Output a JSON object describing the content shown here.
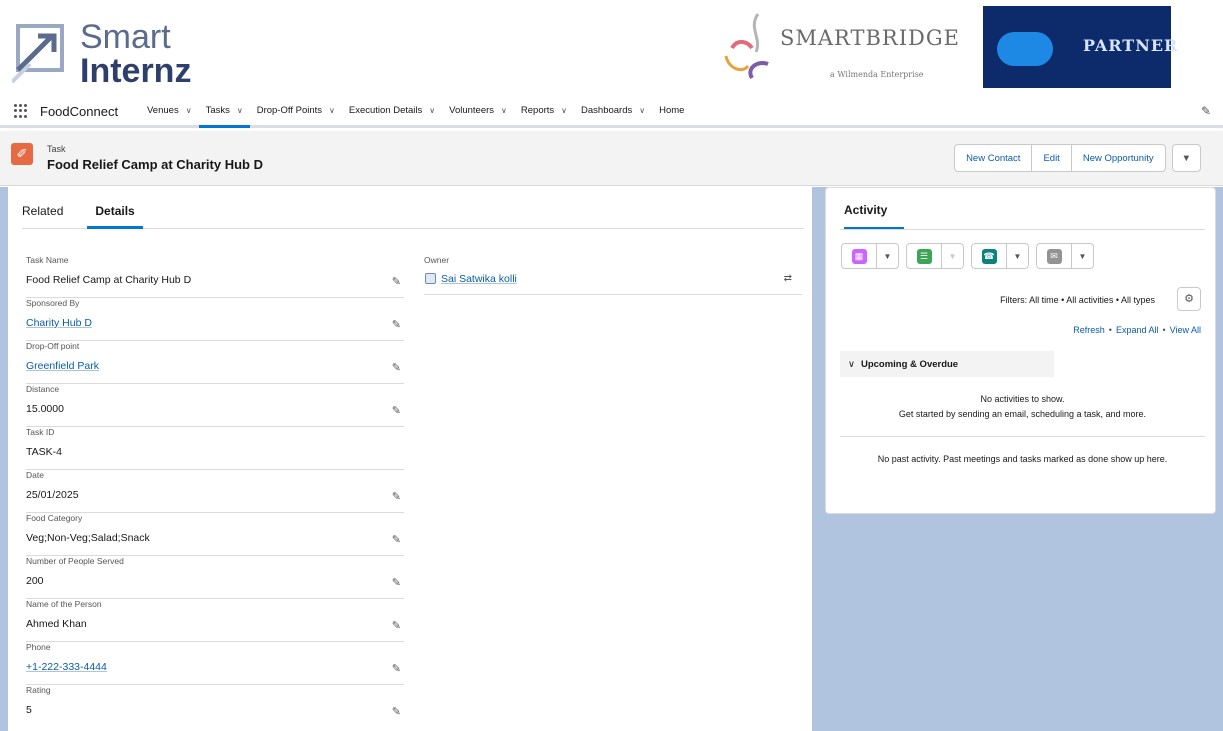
{
  "branding": {
    "smartinternz_line1": "Smart",
    "smartinternz_line2": "Internz",
    "smartbridge_name": "SMARTBRIDGE",
    "smartbridge_sub": "a Wilmenda Enterprise",
    "partner_label": "PARTNER"
  },
  "nav": {
    "app_name": "FoodConnect",
    "items": [
      {
        "label": "Venues",
        "has_menu": true
      },
      {
        "label": "Tasks",
        "has_menu": true,
        "active": true
      },
      {
        "label": "Drop-Off Points",
        "has_menu": true
      },
      {
        "label": "Execution Details",
        "has_menu": true
      },
      {
        "label": "Volunteers",
        "has_menu": true
      },
      {
        "label": "Reports",
        "has_menu": true
      },
      {
        "label": "Dashboards",
        "has_menu": true
      },
      {
        "label": "Home",
        "has_menu": false
      }
    ]
  },
  "record": {
    "object_label": "Task",
    "title": "Food Relief Camp at Charity Hub D",
    "actions": {
      "new_contact": "New Contact",
      "edit": "Edit",
      "new_opportunity": "New Opportunity"
    }
  },
  "tabs": {
    "related": "Related",
    "details": "Details"
  },
  "fields": [
    {
      "label": "Task Name",
      "value": "Food Relief Camp at Charity Hub D",
      "link": false,
      "editable": true
    },
    {
      "label": "Sponsored By",
      "value": "Charity Hub D",
      "link": true,
      "editable": true
    },
    {
      "label": "Drop-Off point",
      "value": "Greenfield Park",
      "link": true,
      "editable": true
    },
    {
      "label": "Distance",
      "value": "15.0000",
      "link": false,
      "editable": true
    },
    {
      "label": "Task ID",
      "value": "TASK-4",
      "link": false,
      "editable": false
    },
    {
      "label": "Date",
      "value": "25/01/2025",
      "link": false,
      "editable": true
    },
    {
      "label": "Food Category",
      "value": "Veg;Non-Veg;Salad;Snack",
      "link": false,
      "editable": true
    },
    {
      "label": "Number of People Served",
      "value": "200",
      "link": false,
      "editable": true
    },
    {
      "label": "Name of the Person",
      "value": "Ahmed Khan",
      "link": false,
      "editable": true
    },
    {
      "label": "Phone",
      "value": "+1-222-333-4444",
      "link": true,
      "editable": true
    },
    {
      "label": "Rating",
      "value": "5",
      "link": false,
      "editable": true
    }
  ],
  "owner": {
    "label": "Owner",
    "value": "Sai Satwika kolli"
  },
  "activity": {
    "title": "Activity",
    "filters_text": "Filters: All time • All activities • All types",
    "refresh": "Refresh",
    "expand_all": "Expand All",
    "view_all": "View All",
    "upcoming_label": "Upcoming & Overdue",
    "no_activities": "No activities to show.",
    "get_started": "Get started by sending an email, scheduling a task, and more.",
    "past_text": "No past activity. Past meetings and tasks marked as done show up here.",
    "buttons": [
      {
        "icon": "calendar-icon",
        "color": "#cb65ff"
      },
      {
        "icon": "task-icon",
        "color": "#3ba755"
      },
      {
        "icon": "call-icon",
        "color": "#0b827c"
      },
      {
        "icon": "email-icon",
        "color": "#939393"
      }
    ]
  },
  "colors": {
    "accent": "#0176d3",
    "link": "#0b5cab",
    "task_icon": "#e66b44",
    "page_bg": "#b0c4df"
  }
}
